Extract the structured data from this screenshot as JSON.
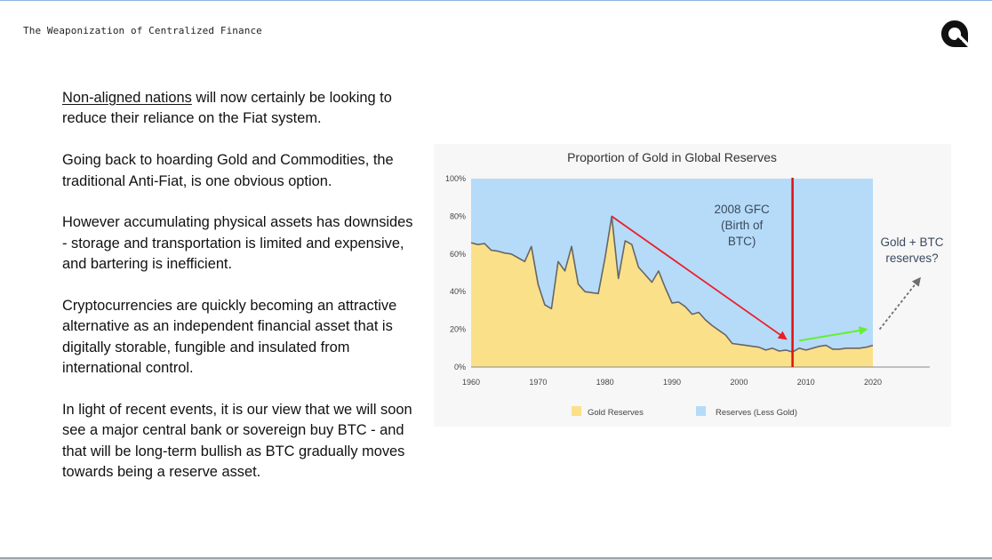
{
  "header": {
    "title": "The Weaponization of Centralized Finance"
  },
  "logo": {
    "icon": "q-logo-icon",
    "color": "#111111"
  },
  "body": {
    "p1_link": "Non-aligned nations",
    "p1_rest": " will now certainly be looking to reduce their reliance on the Fiat system.",
    "p2": "Going back to hoarding Gold and Commodities, the traditional Anti-Fiat, is one obvious option.",
    "p3": "However accumulating physical assets has downsides - storage and transportation is limited and expensive, and bartering is inefficient.",
    "p4": "Cryptocurrencies are quickly becoming an attractive alternative as an independent financial asset that is digitally storable, fungible and insulated from international control.",
    "p5": "In light of recent events, it is our view that we will soon see a major central bank or sovereign buy BTC - and that will be long-term bullish as BTC gradually moves towards being a reserve asset."
  },
  "chart_data": {
    "type": "area",
    "title": "Proportion of Gold in Global Reserves",
    "xlim": [
      1960,
      2020
    ],
    "ylim": [
      0,
      100
    ],
    "x_ticks": [
      "1960",
      "1970",
      "1980",
      "1990",
      "2000",
      "2010",
      "2020"
    ],
    "y_ticks": [
      "0%",
      "20%",
      "40%",
      "60%",
      "80%",
      "100%"
    ],
    "series": [
      {
        "name": "Gold Reserves",
        "color": "#fbe08a",
        "x": [
          1960,
          1961,
          1962,
          1963,
          1964,
          1965,
          1966,
          1967,
          1968,
          1969,
          1970,
          1971,
          1972,
          1973,
          1974,
          1975,
          1976,
          1977,
          1978,
          1979,
          1980,
          1981,
          1982,
          1983,
          1984,
          1985,
          1986,
          1987,
          1988,
          1989,
          1990,
          1991,
          1992,
          1993,
          1994,
          1995,
          1996,
          1997,
          1998,
          1999,
          2000,
          2001,
          2002,
          2003,
          2004,
          2005,
          2006,
          2007,
          2008,
          2009,
          2010,
          2011,
          2012,
          2013,
          2014,
          2015,
          2016,
          2017,
          2018,
          2019,
          2020
        ],
        "values": [
          66,
          65,
          65.5,
          62,
          61.5,
          60.5,
          60,
          58,
          56,
          64,
          44,
          33,
          31,
          56,
          51,
          64,
          44,
          40,
          39.5,
          39,
          58,
          80,
          47,
          67,
          65,
          53,
          49,
          45,
          51,
          42,
          34,
          34.5,
          32,
          28,
          29,
          25,
          22,
          19.5,
          17,
          12.5,
          12,
          11.5,
          11,
          10.5,
          9,
          10,
          8.5,
          9,
          8,
          10,
          9,
          10,
          11,
          11.5,
          9.5,
          9.5,
          10,
          10,
          10,
          10.5,
          11.5
        ]
      },
      {
        "name": "Reserves (Less Gold)",
        "color": "#b5dbf8"
      }
    ],
    "annotations": {
      "gfc_year": 2008,
      "gfc_label": [
        "2008 GFC",
        "(Birth of",
        "BTC)"
      ],
      "btc_label": [
        "Gold + BTC",
        "reserves?"
      ],
      "red_arrow": {
        "from": [
          1981,
          80
        ],
        "to": [
          2007,
          15
        ],
        "color": "#ee1c25"
      },
      "green_arrow": {
        "from": [
          2009,
          14
        ],
        "to": [
          2019,
          20
        ],
        "color": "#66ee33"
      },
      "grey_arrow": {
        "from": [
          2021,
          20
        ],
        "to": [
          2027,
          47
        ],
        "color": "#6e6e6e"
      },
      "vline_color": "#dd1111"
    },
    "legend": {
      "position": "bottom"
    },
    "grid": false
  }
}
